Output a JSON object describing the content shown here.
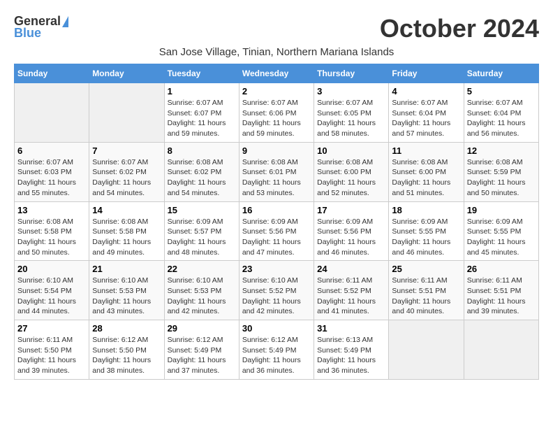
{
  "logo": {
    "general": "General",
    "blue": "Blue"
  },
  "title": "October 2024",
  "subtitle": "San Jose Village, Tinian, Northern Mariana Islands",
  "days_header": [
    "Sunday",
    "Monday",
    "Tuesday",
    "Wednesday",
    "Thursday",
    "Friday",
    "Saturday"
  ],
  "weeks": [
    [
      {
        "day": "",
        "info": ""
      },
      {
        "day": "",
        "info": ""
      },
      {
        "day": "1",
        "info": "Sunrise: 6:07 AM\nSunset: 6:07 PM\nDaylight: 11 hours and 59 minutes."
      },
      {
        "day": "2",
        "info": "Sunrise: 6:07 AM\nSunset: 6:06 PM\nDaylight: 11 hours and 59 minutes."
      },
      {
        "day": "3",
        "info": "Sunrise: 6:07 AM\nSunset: 6:05 PM\nDaylight: 11 hours and 58 minutes."
      },
      {
        "day": "4",
        "info": "Sunrise: 6:07 AM\nSunset: 6:04 PM\nDaylight: 11 hours and 57 minutes."
      },
      {
        "day": "5",
        "info": "Sunrise: 6:07 AM\nSunset: 6:04 PM\nDaylight: 11 hours and 56 minutes."
      }
    ],
    [
      {
        "day": "6",
        "info": "Sunrise: 6:07 AM\nSunset: 6:03 PM\nDaylight: 11 hours and 55 minutes."
      },
      {
        "day": "7",
        "info": "Sunrise: 6:07 AM\nSunset: 6:02 PM\nDaylight: 11 hours and 54 minutes."
      },
      {
        "day": "8",
        "info": "Sunrise: 6:08 AM\nSunset: 6:02 PM\nDaylight: 11 hours and 54 minutes."
      },
      {
        "day": "9",
        "info": "Sunrise: 6:08 AM\nSunset: 6:01 PM\nDaylight: 11 hours and 53 minutes."
      },
      {
        "day": "10",
        "info": "Sunrise: 6:08 AM\nSunset: 6:00 PM\nDaylight: 11 hours and 52 minutes."
      },
      {
        "day": "11",
        "info": "Sunrise: 6:08 AM\nSunset: 6:00 PM\nDaylight: 11 hours and 51 minutes."
      },
      {
        "day": "12",
        "info": "Sunrise: 6:08 AM\nSunset: 5:59 PM\nDaylight: 11 hours and 50 minutes."
      }
    ],
    [
      {
        "day": "13",
        "info": "Sunrise: 6:08 AM\nSunset: 5:58 PM\nDaylight: 11 hours and 50 minutes."
      },
      {
        "day": "14",
        "info": "Sunrise: 6:08 AM\nSunset: 5:58 PM\nDaylight: 11 hours and 49 minutes."
      },
      {
        "day": "15",
        "info": "Sunrise: 6:09 AM\nSunset: 5:57 PM\nDaylight: 11 hours and 48 minutes."
      },
      {
        "day": "16",
        "info": "Sunrise: 6:09 AM\nSunset: 5:56 PM\nDaylight: 11 hours and 47 minutes."
      },
      {
        "day": "17",
        "info": "Sunrise: 6:09 AM\nSunset: 5:56 PM\nDaylight: 11 hours and 46 minutes."
      },
      {
        "day": "18",
        "info": "Sunrise: 6:09 AM\nSunset: 5:55 PM\nDaylight: 11 hours and 46 minutes."
      },
      {
        "day": "19",
        "info": "Sunrise: 6:09 AM\nSunset: 5:55 PM\nDaylight: 11 hours and 45 minutes."
      }
    ],
    [
      {
        "day": "20",
        "info": "Sunrise: 6:10 AM\nSunset: 5:54 PM\nDaylight: 11 hours and 44 minutes."
      },
      {
        "day": "21",
        "info": "Sunrise: 6:10 AM\nSunset: 5:53 PM\nDaylight: 11 hours and 43 minutes."
      },
      {
        "day": "22",
        "info": "Sunrise: 6:10 AM\nSunset: 5:53 PM\nDaylight: 11 hours and 42 minutes."
      },
      {
        "day": "23",
        "info": "Sunrise: 6:10 AM\nSunset: 5:52 PM\nDaylight: 11 hours and 42 minutes."
      },
      {
        "day": "24",
        "info": "Sunrise: 6:11 AM\nSunset: 5:52 PM\nDaylight: 11 hours and 41 minutes."
      },
      {
        "day": "25",
        "info": "Sunrise: 6:11 AM\nSunset: 5:51 PM\nDaylight: 11 hours and 40 minutes."
      },
      {
        "day": "26",
        "info": "Sunrise: 6:11 AM\nSunset: 5:51 PM\nDaylight: 11 hours and 39 minutes."
      }
    ],
    [
      {
        "day": "27",
        "info": "Sunrise: 6:11 AM\nSunset: 5:50 PM\nDaylight: 11 hours and 39 minutes."
      },
      {
        "day": "28",
        "info": "Sunrise: 6:12 AM\nSunset: 5:50 PM\nDaylight: 11 hours and 38 minutes."
      },
      {
        "day": "29",
        "info": "Sunrise: 6:12 AM\nSunset: 5:49 PM\nDaylight: 11 hours and 37 minutes."
      },
      {
        "day": "30",
        "info": "Sunrise: 6:12 AM\nSunset: 5:49 PM\nDaylight: 11 hours and 36 minutes."
      },
      {
        "day": "31",
        "info": "Sunrise: 6:13 AM\nSunset: 5:49 PM\nDaylight: 11 hours and 36 minutes."
      },
      {
        "day": "",
        "info": ""
      },
      {
        "day": "",
        "info": ""
      }
    ]
  ]
}
